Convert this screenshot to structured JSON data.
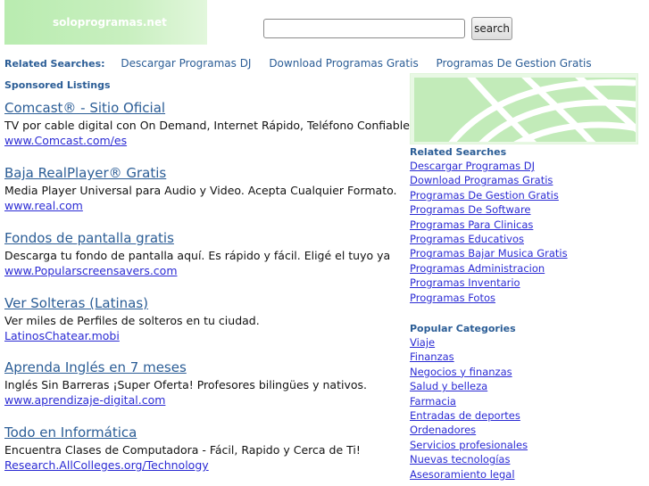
{
  "site": {
    "logo_text": "soloprogramas.net"
  },
  "search": {
    "placeholder": "",
    "button_label": "search"
  },
  "related_bar": {
    "label": "Related Searches:",
    "links": [
      "Descargar Programas DJ",
      "Download Programas Gratis",
      "Programas De Gestion Gratis"
    ]
  },
  "sponsored": {
    "heading": "Sponsored Listings",
    "listings": [
      {
        "title": "Comcast® - Sitio Oficial",
        "desc": "TV por cable digital con On Demand, Internet Rápido, Teléfono Confiable",
        "url": "www.Comcast.com/es"
      },
      {
        "title": "Baja RealPlayer® Gratis",
        "desc": "Media Player Universal para Audio y Video. Acepta Cualquier Formato.",
        "url": "www.real.com"
      },
      {
        "title": "Fondos de pantalla gratis",
        "desc": "Descarga tu fondo de pantalla aquí. Es rápido y fácil. Eligé el tuyo ya",
        "url": "www.Popularscreensavers.com"
      },
      {
        "title": "Ver Solteras (Latinas)",
        "desc": "Ver miles de Perfiles de solteros en tu ciudad.",
        "url": "LatinosChatear.mobi"
      },
      {
        "title": "Aprenda Inglés en 7 meses",
        "desc": "Inglés Sin Barreras ¡Super Oferta! Profesores bilingües y nativos.",
        "url": "www.aprendizaje-digital.com"
      },
      {
        "title": "Todo en Informática",
        "desc": "Encuentra Clases de Computadora - Fácil, Rapido y Cerca de Ti!",
        "url": "Research.AllColleges.org/Technology"
      }
    ]
  },
  "sidebar": {
    "related_heading": "Related Searches",
    "related_links": [
      "Descargar Programas DJ",
      "Download Programas Gratis",
      "Programas De Gestion Gratis",
      "Programas De Software",
      "Programas Para Clinicas",
      "Programas Educativos",
      "Programas Bajar Musica Gratis",
      "Programas Administracion",
      "Programas Inventario",
      "Programas Fotos"
    ],
    "categories_heading": "Popular Categories",
    "categories": [
      "Viaje",
      "Finanzas",
      "Negocios y finanzas",
      "Salud y belleza",
      "Farmacia",
      "Entradas de deportes",
      "Ordenadores",
      "Servicios profesionales",
      "Nuevas tecnologías",
      "Asesoramiento legal"
    ]
  }
}
